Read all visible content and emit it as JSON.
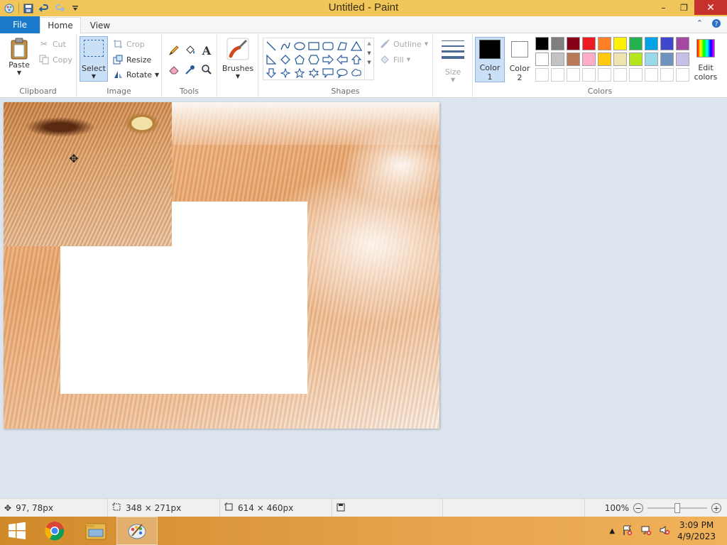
{
  "window": {
    "title": "Untitled - Paint"
  },
  "tabs": {
    "file": "File",
    "home": "Home",
    "view": "View"
  },
  "ribbon": {
    "clipboard": {
      "label": "Clipboard",
      "paste": "Paste",
      "cut": "Cut",
      "copy": "Copy"
    },
    "image": {
      "label": "Image",
      "select": "Select",
      "crop": "Crop",
      "resize": "Resize",
      "rotate": "Rotate"
    },
    "tools": {
      "label": "Tools"
    },
    "brushes": {
      "label": "Brushes"
    },
    "shapes": {
      "label": "Shapes",
      "outline": "Outline",
      "fill": "Fill"
    },
    "size": {
      "label": "Size"
    },
    "colors": {
      "label": "Colors",
      "color1": "Color",
      "color1_num": "1",
      "color2": "Color",
      "color2_num": "2",
      "edit": "Edit",
      "edit2": "colors",
      "color1_value": "#000000",
      "color2_value": "#ffffff",
      "palette_row1": [
        "#000000",
        "#7f7f7f",
        "#880015",
        "#ed1c24",
        "#ff7f27",
        "#fff200",
        "#22b14c",
        "#00a2e8",
        "#3f48cc",
        "#a349a4"
      ],
      "palette_row2": [
        "#ffffff",
        "#c3c3c3",
        "#b97a57",
        "#ffaec9",
        "#ffc90e",
        "#efe4b0",
        "#b5e61d",
        "#99d9ea",
        "#7092be",
        "#c8bfe7"
      ],
      "palette_row3": [
        "#ffffff",
        "#ffffff",
        "#ffffff",
        "#ffffff",
        "#ffffff",
        "#ffffff",
        "#ffffff",
        "#ffffff",
        "#ffffff",
        "#ffffff"
      ]
    }
  },
  "status": {
    "cursor_pos": "97, 78px",
    "selection_size": "348 × 271px",
    "image_size": "614 × 460px",
    "zoom": "100%"
  },
  "taskbar": {
    "time": "3:09 PM",
    "date": "4/9/2023"
  }
}
